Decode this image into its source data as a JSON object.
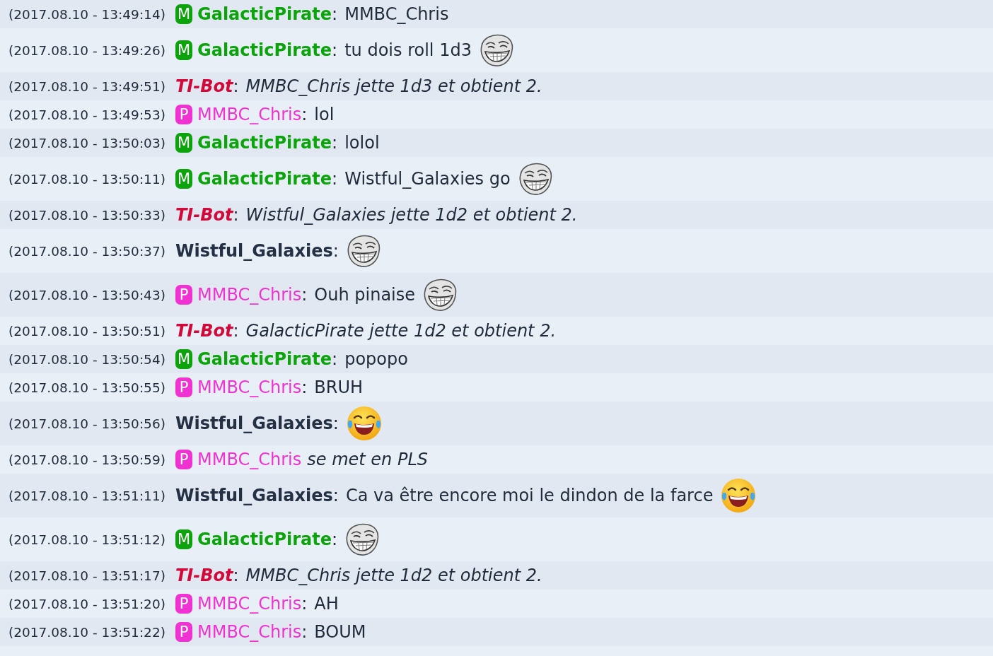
{
  "messages": [
    {
      "time": "(2017.08.10 - 13:49:14)",
      "kind": "say",
      "author": {
        "kind": "moderator",
        "badge": "M",
        "name": "GalacticPirate"
      },
      "sep": ":",
      "text": "MMBC_Chris"
    },
    {
      "time": "(2017.08.10 - 13:49:26)",
      "kind": "say",
      "author": {
        "kind": "moderator",
        "badge": "M",
        "name": "GalacticPirate"
      },
      "sep": ":",
      "text": "tu dois roll 1d3",
      "emoticon": {
        "kind": "troll"
      }
    },
    {
      "time": "(2017.08.10 - 13:49:51)",
      "kind": "action",
      "author": {
        "kind": "bot",
        "name": "TI-Bot"
      },
      "sep": ":",
      "text": "MMBC_Chris jette 1d3 et obtient 2."
    },
    {
      "time": "(2017.08.10 - 13:49:53)",
      "kind": "say",
      "author": {
        "kind": "player",
        "badge": "P",
        "name": "MMBC_Chris"
      },
      "sep": ":",
      "text": "lol"
    },
    {
      "time": "(2017.08.10 - 13:50:03)",
      "kind": "say",
      "author": {
        "kind": "moderator",
        "badge": "M",
        "name": "GalacticPirate"
      },
      "sep": ":",
      "text": "lolol"
    },
    {
      "time": "(2017.08.10 - 13:50:11)",
      "kind": "say",
      "author": {
        "kind": "moderator",
        "badge": "M",
        "name": "GalacticPirate"
      },
      "sep": ":",
      "text": "Wistful_Galaxies go",
      "emoticon": {
        "kind": "troll"
      }
    },
    {
      "time": "(2017.08.10 - 13:50:33)",
      "kind": "action",
      "author": {
        "kind": "bot",
        "name": "TI-Bot"
      },
      "sep": ":",
      "text": "Wistful_Galaxies jette 1d2 et obtient 2."
    },
    {
      "time": "(2017.08.10 - 13:50:37)",
      "author": {
        "kind": "user",
        "name": "Wistful_Galaxies"
      },
      "sep": ":",
      "emoticon": {
        "kind": "troll"
      }
    },
    {
      "time": "(2017.08.10 - 13:50:43)",
      "kind": "say",
      "author": {
        "kind": "player",
        "badge": "P",
        "name": "MMBC_Chris"
      },
      "sep": ":",
      "text": "Ouh pinaise",
      "emoticon": {
        "kind": "troll"
      }
    },
    {
      "time": "(2017.08.10 - 13:50:51)",
      "kind": "action",
      "author": {
        "kind": "bot",
        "name": "TI-Bot"
      },
      "sep": ":",
      "text": "GalacticPirate jette 1d2 et obtient 2."
    },
    {
      "time": "(2017.08.10 - 13:50:54)",
      "kind": "say",
      "author": {
        "kind": "moderator",
        "badge": "M",
        "name": "GalacticPirate"
      },
      "sep": ":",
      "text": "popopo"
    },
    {
      "time": "(2017.08.10 - 13:50:55)",
      "kind": "say",
      "author": {
        "kind": "player",
        "badge": "P",
        "name": "MMBC_Chris"
      },
      "sep": ":",
      "text": "BRUH"
    },
    {
      "time": "(2017.08.10 - 13:50:56)",
      "author": {
        "kind": "user",
        "name": "Wistful_Galaxies"
      },
      "sep": ":",
      "emoticon": {
        "kind": "laugh"
      }
    },
    {
      "time": "(2017.08.10 - 13:50:59)",
      "kind": "me",
      "author": {
        "kind": "player",
        "badge": "P",
        "name": "MMBC_Chris"
      },
      "text": "se met en PLS"
    },
    {
      "time": "(2017.08.10 - 13:51:11)",
      "kind": "say",
      "author": {
        "kind": "user",
        "name": "Wistful_Galaxies"
      },
      "sep": ":",
      "text": "Ca va être encore moi le dindon de la farce",
      "emoticon": {
        "kind": "laugh"
      }
    },
    {
      "time": "(2017.08.10 - 13:51:12)",
      "author": {
        "kind": "moderator",
        "badge": "M",
        "name": "GalacticPirate"
      },
      "sep": ":",
      "emoticon": {
        "kind": "troll"
      }
    },
    {
      "time": "(2017.08.10 - 13:51:17)",
      "kind": "action",
      "author": {
        "kind": "bot",
        "name": "TI-Bot"
      },
      "sep": ":",
      "text": "MMBC_Chris jette 1d2 et obtient 2."
    },
    {
      "time": "(2017.08.10 - 13:51:20)",
      "kind": "say",
      "author": {
        "kind": "player",
        "badge": "P",
        "name": "MMBC_Chris"
      },
      "sep": ":",
      "text": "AH"
    },
    {
      "time": "(2017.08.10 - 13:51:22)",
      "kind": "say",
      "author": {
        "kind": "player",
        "badge": "P",
        "name": "MMBC_Chris"
      },
      "sep": ":",
      "text": "BOUM"
    }
  ]
}
